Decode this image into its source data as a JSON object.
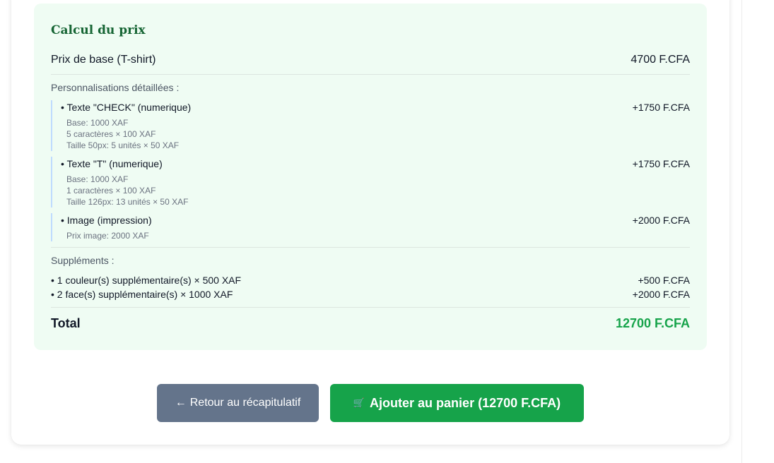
{
  "price_calc": {
    "title": "Calcul du prix",
    "base": {
      "label": "Prix de base (T-shirt)",
      "value": "4700 F.CFA"
    },
    "custom_label": "Personnalisations détaillées :",
    "customizations": [
      {
        "title": "• Texte \"CHECK\" (numerique)",
        "price": "+1750 F.CFA",
        "details": [
          "Base: 1000 XAF",
          "5 caractères × 100 XAF",
          "Taille 50px: 5 unités × 50 XAF"
        ]
      },
      {
        "title": "• Texte \"T\" (numerique)",
        "price": "+1750 F.CFA",
        "details": [
          "Base: 1000 XAF",
          "1 caractères × 100 XAF",
          "Taille 126px: 13 unités × 50 XAF"
        ]
      },
      {
        "title": "• Image (impression)",
        "price": "+2000 F.CFA",
        "details": [
          "Prix image: 2000 XAF"
        ]
      }
    ],
    "supp_label": "Suppléments :",
    "supplements": [
      {
        "label": "• 1 couleur(s) supplémentaire(s) × 500 XAF",
        "price": "+500 F.CFA"
      },
      {
        "label": "• 2 face(s) supplémentaire(s) × 1000 XAF",
        "price": "+2000 F.CFA"
      }
    ],
    "total": {
      "label": "Total",
      "value": "12700 F.CFA"
    }
  },
  "actions": {
    "back_arrow": "←",
    "back_label": "Retour au récapitulatif",
    "cart_glyph": "🛒",
    "add_label": "Ajouter au panier (12700 F.CFA)"
  },
  "colors": {
    "panel_bg": "#effcf3",
    "title": "#166534",
    "total": "#16a34a",
    "back_button": "#64748b",
    "add_button": "#16a34a"
  },
  "icons": {
    "back": "arrow-left-icon",
    "cart": "shopping-cart-icon"
  }
}
